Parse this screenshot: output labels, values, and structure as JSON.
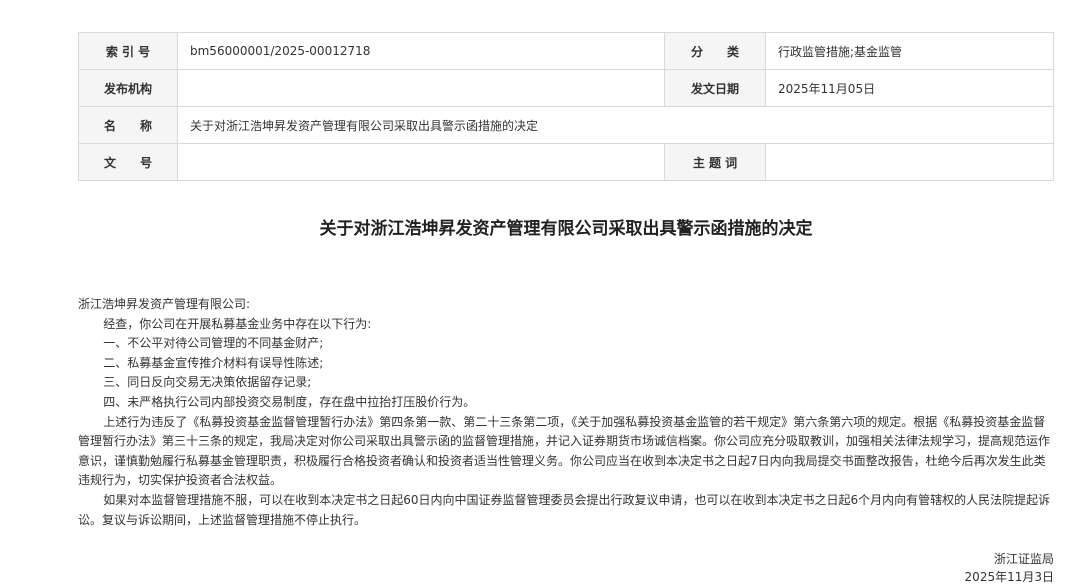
{
  "meta": {
    "index_label": "索 引 号",
    "index_value": "bm56000001/2025-00012718",
    "category_label": "分　　类",
    "category_value": "行政监管措施;基金监管",
    "issuer_label": "发布机构",
    "issuer_value": "",
    "date_label": "发文日期",
    "date_value": "2025年11月05日",
    "name_label": "名　　称",
    "name_value": "关于对浙江浩坤昇发资产管理有限公司采取出具警示函措施的决定",
    "docno_label": "文　　号",
    "docno_value": "",
    "subject_label": "主 题 词",
    "subject_value": ""
  },
  "title": "关于对浙江浩坤昇发资产管理有限公司采取出具警示函措施的决定",
  "body": {
    "salutation": "浙江浩坤昇发资产管理有限公司:",
    "paragraphs": [
      "经查，你公司在开展私募基金业务中存在以下行为:",
      "一、不公平对待公司管理的不同基金财产;",
      "二、私募基金宣传推介材料有误导性陈述;",
      "三、同日反向交易无决策依据留存记录;",
      "四、未严格执行公司内部投资交易制度，存在盘中拉抬打压股价行为。",
      "上述行为违反了《私募投资基金监督管理暂行办法》第四条第一款、第二十三条第二项，《关于加强私募投资基金监管的若干规定》第六条第六项的规定。根据《私募投资基金监督管理暂行办法》第三十三条的规定，我局决定对你公司采取出具警示函的监督管理措施，并记入证券期货市场诚信档案。你公司应充分吸取教训，加强相关法律法规学习，提高规范运作意识，谨慎勤勉履行私募基金管理职责，积极履行合格投资者确认和投资者适当性管理义务。你公司应当在收到本决定书之日起7日内向我局提交书面整改报告，杜绝今后再次发生此类违规行为，切实保护投资者合法权益。",
      "如果对本监督管理措施不服，可以在收到本决定书之日起60日内向中国证券监督管理委员会提出行政复议申请，也可以在收到本决定书之日起6个月内向有管辖权的人民法院提起诉讼。复议与诉讼期间，上述监督管理措施不停止执行。"
    ]
  },
  "signature": {
    "org": "浙江证监局",
    "date": "2025年11月3日"
  }
}
